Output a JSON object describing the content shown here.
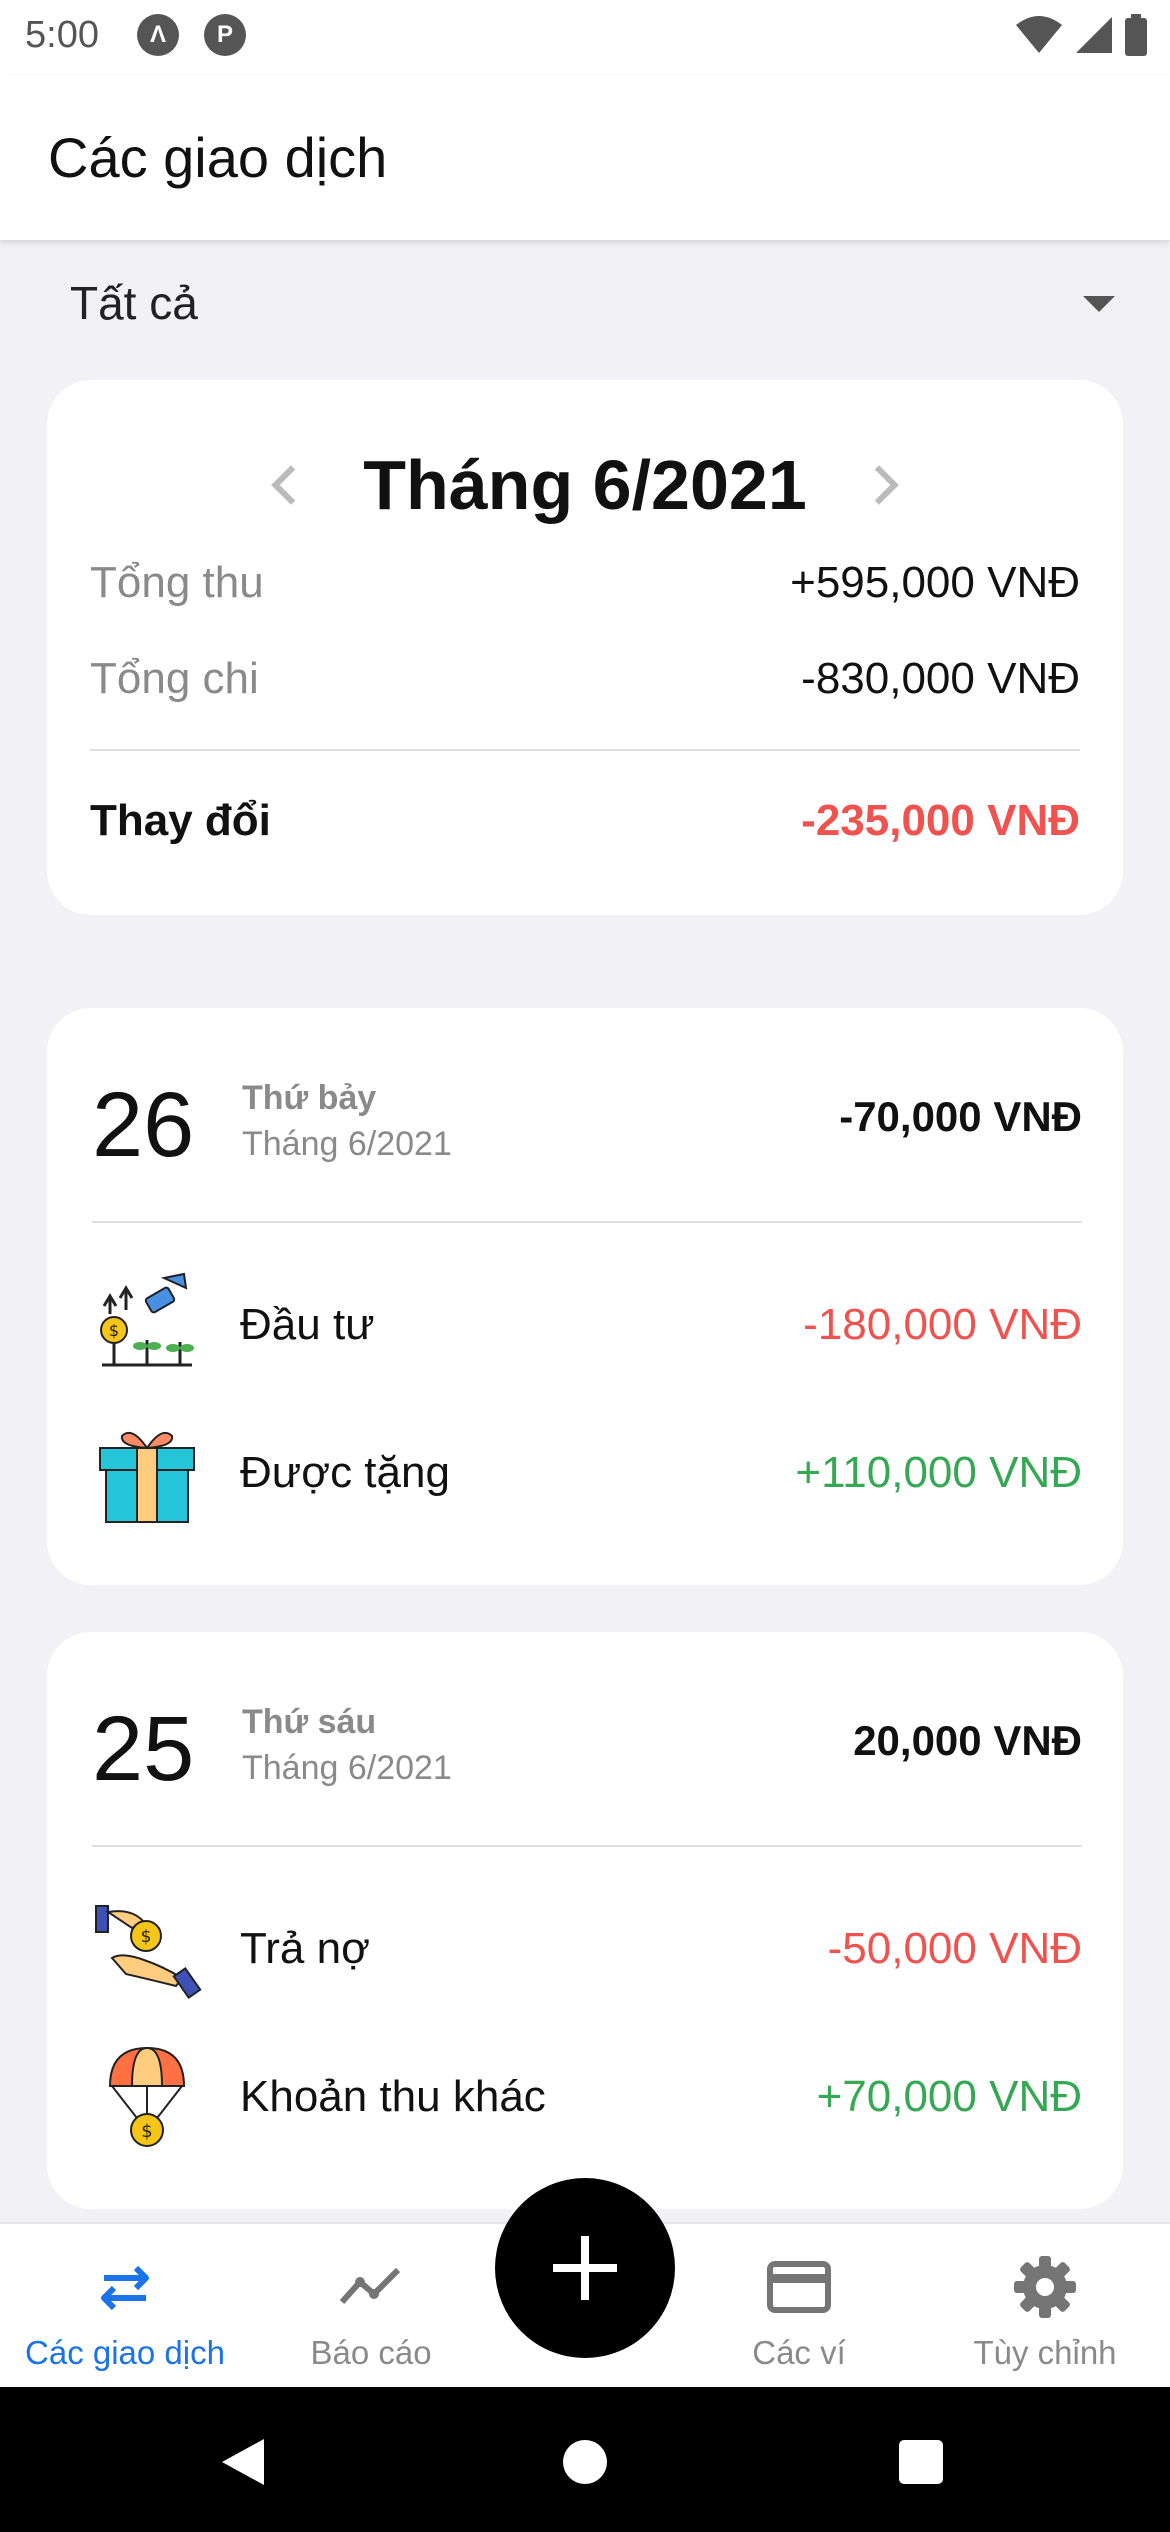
{
  "status_bar": {
    "time": "5:00",
    "icons": [
      "a-circle-icon",
      "p-circle-icon",
      "wifi-icon",
      "signal-icon",
      "battery-icon"
    ]
  },
  "app_bar": {
    "title": "Các giao dịch"
  },
  "filter": {
    "selected": "Tất cả",
    "icon": "dropdown-caret-icon"
  },
  "summary": {
    "month_label": "Tháng 6/2021",
    "income_label": "Tổng thu",
    "income_value": "+595,000 VNĐ",
    "expense_label": "Tổng chi",
    "expense_value": "-830,000 VNĐ",
    "change_label": "Thay đổi",
    "change_value": "-235,000 VNĐ"
  },
  "days": [
    {
      "day": "26",
      "weekday": "Thứ bảy",
      "month": "Tháng 6/2021",
      "total": "-70,000 VNĐ",
      "transactions": [
        {
          "name": "Đầu tư",
          "amount": "-180,000 VNĐ",
          "type": "expense",
          "icon": "investment-icon"
        },
        {
          "name": "Được tặng",
          "amount": "+110,000 VNĐ",
          "type": "income",
          "icon": "gift-icon"
        }
      ]
    },
    {
      "day": "25",
      "weekday": "Thứ sáu",
      "month": "Tháng 6/2021",
      "total": "20,000 VNĐ",
      "transactions": [
        {
          "name": "Trả nợ",
          "amount": "-50,000 VNĐ",
          "type": "expense",
          "icon": "debt-repayment-icon"
        },
        {
          "name": "Khoản thu khác",
          "amount": "+70,000 VNĐ",
          "type": "income",
          "icon": "parachute-coin-icon"
        }
      ]
    }
  ],
  "bottom_nav": {
    "items": [
      {
        "label": "Các giao dịch",
        "icon": "swap-arrows-icon",
        "active": true
      },
      {
        "label": "Báo cáo",
        "icon": "trend-line-icon",
        "active": false
      },
      {
        "label": "Các ví",
        "icon": "card-icon",
        "active": false
      },
      {
        "label": "Tùy chỉnh",
        "icon": "gear-icon",
        "active": false
      }
    ],
    "fab_icon": "plus-icon"
  },
  "colors": {
    "accent": "#1a73e8",
    "negative": "#ef5350",
    "positive": "#34a853",
    "background": "#f2f2f6"
  }
}
